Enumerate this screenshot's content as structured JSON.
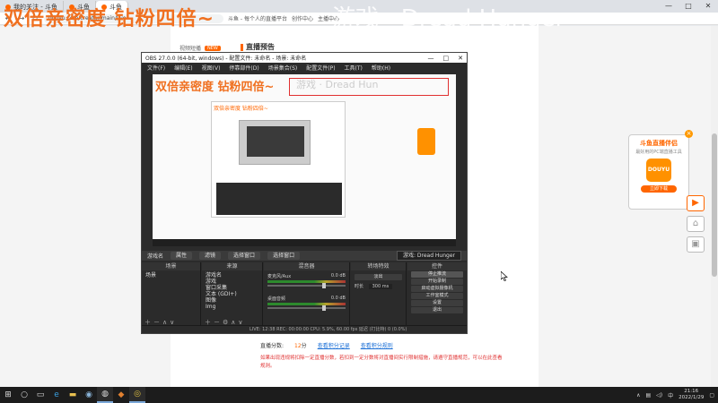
{
  "browser": {
    "tabs": [
      {
        "label": "我的关注 - 斗鱼"
      },
      {
        "label": "斗鱼"
      },
      {
        "label": "斗鱼"
      }
    ],
    "address": "douyu.com/creator/main/live",
    "bookmarks": [
      "斗鱼 - 每个人的直播平台",
      "创作中心",
      "主播中心"
    ],
    "window_controls": [
      "—",
      "□",
      "✕"
    ]
  },
  "overlay": {
    "main_text": "双倍亲密度 钻粉四倍~",
    "watermark": "游戏 · Dread Hunger"
  },
  "page": {
    "breadcrumb": "视频短播",
    "hot_badge": "NEW",
    "section_title": "直播预告",
    "info": {
      "duration_label": "直播分数:",
      "duration_value": "12",
      "duration_unit": "分",
      "link1": "查看积分记录",
      "link2": "查看积分规则"
    },
    "note": "如果出现违规将扣除一定直播分数，若扣到一定分数将对直播间实行限制措施，请遵守直播规范，可以在此查看规则。"
  },
  "promo": {
    "title": "斗鱼直播伴侣",
    "subtitle": "最好用的PC端直播工具",
    "logo_text": "DOUYU",
    "download": "立即下载",
    "close": "×"
  },
  "obs": {
    "title": "OBS 27.0.0 (64-bit, windows) - 配置文件: 未命名 - 场景: 未命名",
    "menu": [
      "文件(F)",
      "编辑(E)",
      "视图(V)",
      "停靠部件(D)",
      "场景集合(S)",
      "配置文件(P)",
      "工具(T)",
      "帮助(H)"
    ],
    "preview_text": "双倍亲密度 钻粉四倍~",
    "preview_watermark": "游戏 · Dread Hun",
    "context_bar": {
      "source_name": "游戏名",
      "properties": "属性",
      "filters": "滤镜",
      "select_window": "选择窗口",
      "select_window2": "选择窗口",
      "current_source": "游戏: Dread Hunger"
    },
    "scenes": {
      "header": "场景",
      "items": [
        "场景"
      ]
    },
    "sources": {
      "header": "来源",
      "items": [
        "游戏名",
        "游戏",
        "窗口采集",
        "文本 (GDI+)",
        "图像",
        "Img"
      ]
    },
    "mixer": {
      "header": "混音器",
      "channels": [
        {
          "name": "麦克风/Aux",
          "level": "0.0 dB"
        },
        {
          "name": "桌面音频",
          "level": "0.0 dB"
        }
      ]
    },
    "transitions": {
      "header": "转场特效",
      "type": "淡出",
      "duration_label": "时长",
      "duration": "300 ms"
    },
    "controls": {
      "header": "控件",
      "buttons": [
        "停止推流",
        "开始录制",
        "启动虚拟摄像机",
        "工作室模式",
        "设置",
        "退出"
      ]
    },
    "status": "LIVE: 12:38  REC: 00:00:00  CPU: 5.9%, 60.00 fps  延迟 (打比特) 0 (0.0%)"
  },
  "taskbar": {
    "icons": [
      "start-icon",
      "search-icon",
      "task-view-icon",
      "edge-icon",
      "explorer-icon",
      "steam-icon",
      "obs-icon",
      "game-icon",
      "chrome-icon"
    ],
    "time": "21:16",
    "date": "2022/1/29",
    "lang": "中"
  },
  "colors": {
    "accent": "#ff6600",
    "overlay_orange": "#f07020"
  }
}
